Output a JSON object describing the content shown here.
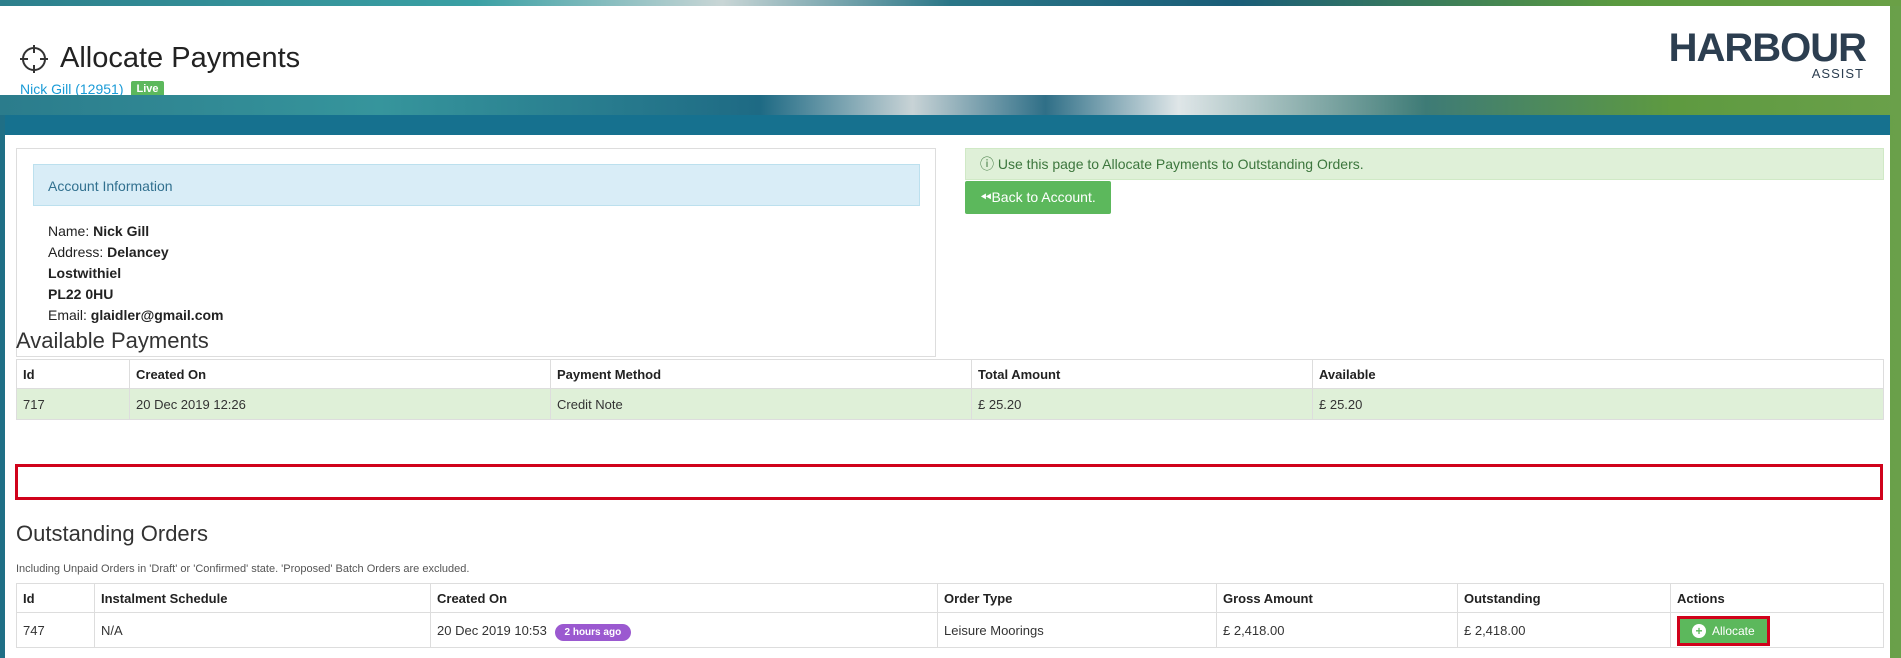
{
  "page": {
    "title": "Allocate Payments",
    "account_link": "Nick Gill (12951)",
    "status_badge": "Live"
  },
  "logo": {
    "main": "HARBOUR",
    "sub": "ASSIST"
  },
  "account_info": {
    "heading": "Account Information",
    "name_label": "Name:",
    "name": "Nick Gill",
    "address_label": "Address:",
    "address_line1": "Delancey",
    "address_line2": "Lostwithiel",
    "address_line3": "PL22 0HU",
    "email_label": "Email:",
    "email": "glaidler@gmail.com"
  },
  "info_alert": "Use this page to Allocate Payments to Outstanding Orders.",
  "back_button": "Back to Account.",
  "available_payments": {
    "title": "Available Payments",
    "columns": [
      "Id",
      "Created On",
      "Payment Method",
      "Total Amount",
      "Available"
    ],
    "rows": [
      {
        "id": "717",
        "created_on": "20 Dec 2019 12:26",
        "method": "Credit Note",
        "total": "£ 25.20",
        "available": "£ 25.20"
      }
    ]
  },
  "outstanding_orders": {
    "title": "Outstanding Orders",
    "note": "Including Unpaid Orders in 'Draft' or 'Confirmed' state. 'Proposed' Batch Orders are excluded.",
    "columns": [
      "Id",
      "Instalment Schedule",
      "Created On",
      "Order Type",
      "Gross Amount",
      "Outstanding",
      "Actions"
    ],
    "rows": [
      {
        "id": "747",
        "schedule": "N/A",
        "created_on": "20 Dec 2019 10:53",
        "age_badge": "2 hours ago",
        "order_type": "Leisure Moorings",
        "gross": "£ 2,418.00",
        "outstanding": "£ 2,418.00",
        "action": "Allocate"
      }
    ]
  },
  "colors": {
    "success": "#5cb85c",
    "info_bg": "#d9edf7",
    "highlight": "#d0021b",
    "brand_bar": "#16718f",
    "badge_purple": "#9b59d0"
  },
  "icons": {
    "title": "crosshair-icon",
    "alert": "info-circle-icon",
    "back": "double-chevron-left-icon",
    "allocate": "plus-circle-icon"
  }
}
